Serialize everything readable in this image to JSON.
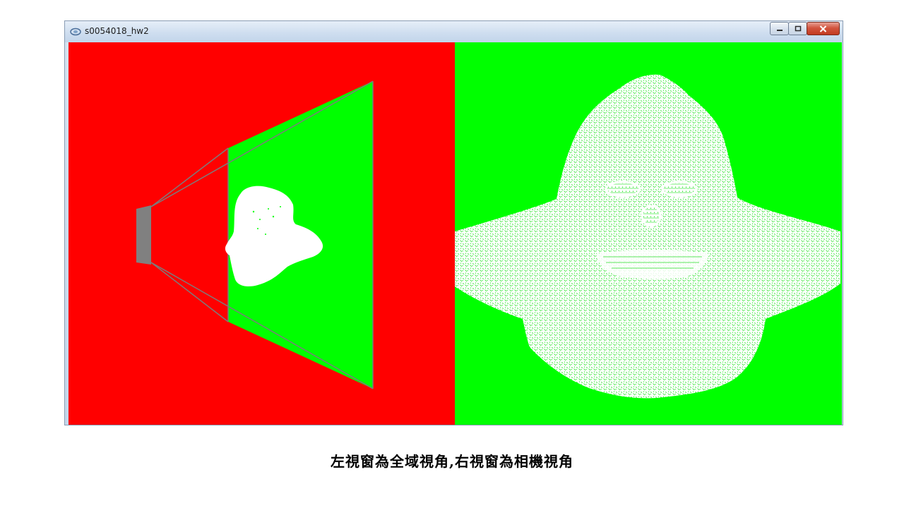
{
  "window": {
    "title": "s0054018_hw2",
    "app_icon": "opengl-app-icon",
    "buttons": {
      "minimize_icon": "minimize-icon",
      "maximize_icon": "maximize-icon",
      "close_icon": "close-icon"
    }
  },
  "viewports": {
    "left": {
      "background": "#ff0000",
      "frustum_far_plane": "#00ff00",
      "camera_color": "#808080"
    },
    "right": {
      "background": "#00ff00",
      "mesh_color": "#ffffff"
    }
  },
  "caption": "左視窗為全域視角,右視窗為相機視角"
}
